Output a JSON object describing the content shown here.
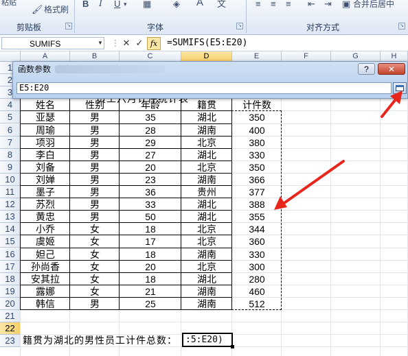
{
  "ribbon": {
    "clipboard_paste": "粘贴",
    "format_painter": "格式刷",
    "clipboard_label": "剪贴板",
    "bold": "B",
    "italic": "I",
    "underline": "U",
    "font_color": "A",
    "font_label": "字体",
    "merge_center": "合并后居中",
    "alignment_label": "对齐方式"
  },
  "formula_bar": {
    "name_box": "SUMIFS",
    "cancel": "✕",
    "enter": "✓",
    "fx": "fx",
    "formula": "=SUMIFS(E5:E20)"
  },
  "columns": [
    "A",
    "B",
    "C",
    "D",
    "E",
    "F",
    "G",
    "H"
  ],
  "rows": [
    "1",
    "2",
    "3",
    "4",
    "5",
    "6",
    "7",
    "8",
    "9",
    "10",
    "11",
    "12",
    "13",
    "14",
    "15",
    "16",
    "17",
    "18",
    "19",
    "20",
    "21",
    "22",
    "23"
  ],
  "sheet": {
    "title": "员工六月计件统计表",
    "headers": [
      "姓名",
      "性别",
      "年龄",
      "籍贯",
      "计件数"
    ],
    "records": [
      [
        "亚瑟",
        "男",
        "35",
        "湖北",
        "350"
      ],
      [
        "周瑜",
        "男",
        "28",
        "湖南",
        "400"
      ],
      [
        "项羽",
        "男",
        "29",
        "北京",
        "380"
      ],
      [
        "李白",
        "男",
        "27",
        "湖北",
        "330"
      ],
      [
        "刘备",
        "男",
        "20",
        "北京",
        "350"
      ],
      [
        "刘婵",
        "男",
        "23",
        "湖南",
        "366"
      ],
      [
        "墨子",
        "男",
        "36",
        "贵州",
        "377"
      ],
      [
        "苏烈",
        "男",
        "33",
        "湖北",
        "388"
      ],
      [
        "黄忠",
        "男",
        "50",
        "湖北",
        "355"
      ],
      [
        "小乔",
        "女",
        "18",
        "北京",
        "344"
      ],
      [
        "虞姬",
        "女",
        "17",
        "北京",
        "360"
      ],
      [
        "妲己",
        "女",
        "18",
        "湖南",
        "330"
      ],
      [
        "孙尚香",
        "女",
        "20",
        "北京",
        "300"
      ],
      [
        "安其拉",
        "女",
        "18",
        "湖北",
        "280"
      ],
      [
        "露娜",
        "女",
        "21",
        "湖南",
        "460"
      ],
      [
        "韩信",
        "男",
        "25",
        "湖南",
        "512"
      ]
    ],
    "row22_label": "籍贯为湖北的男性员工计件总数：",
    "row22_edit": ":5:E20)"
  },
  "dialog": {
    "title": "函数参数",
    "help": "?",
    "close": "✕",
    "range_value": "E5:E20"
  },
  "colors": {
    "annotation_arrow": "#e8261b",
    "selected_header": "#f6cf6a"
  }
}
